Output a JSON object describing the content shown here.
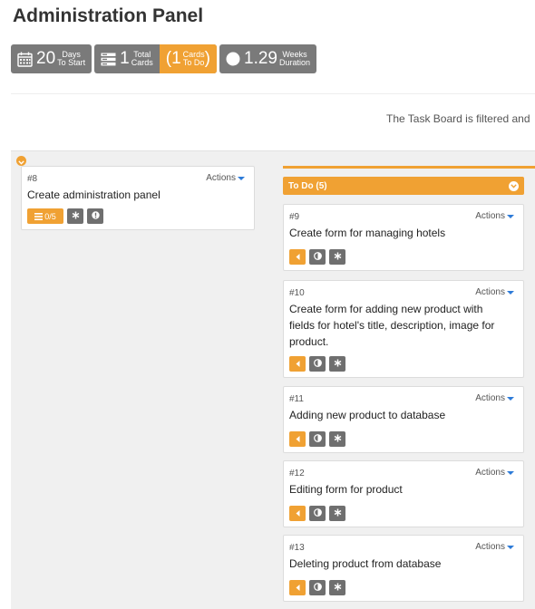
{
  "page": {
    "title": "Administration Panel"
  },
  "stats": {
    "days": {
      "value": "20",
      "label_top": "Days",
      "label_bottom": "To Start"
    },
    "cards": {
      "value": "1",
      "label_top": "Total",
      "label_bottom": "Cards"
    },
    "todo": {
      "open": "(1",
      "label_top": "Cards",
      "label_bottom": "To Do",
      "close": ")"
    },
    "weeks": {
      "value": "1.29",
      "label_top": "Weeks",
      "label_bottom": "Duration"
    }
  },
  "filter_note": "The Task Board is filtered and",
  "parent_card": {
    "number": "#8",
    "actions_label": "Actions",
    "title": "Create administration panel",
    "tasks_badge": "0/5"
  },
  "column": {
    "title": "To Do (5)",
    "cards": [
      {
        "number": "#9",
        "actions_label": "Actions",
        "title_lines": [
          "Create form for managing hotels"
        ]
      },
      {
        "number": "#10",
        "actions_label": "Actions",
        "title_lines": [
          "Create form for adding new product with",
          "fields for hotel's title, description, image for",
          "product."
        ]
      },
      {
        "number": "#11",
        "actions_label": "Actions",
        "title_lines": [
          "Adding new product to database"
        ]
      },
      {
        "number": "#12",
        "actions_label": "Actions",
        "title_lines": [
          "Editing form for product"
        ]
      },
      {
        "number": "#13",
        "actions_label": "Actions",
        "title_lines": [
          "Deleting product from database"
        ]
      }
    ]
  },
  "colors": {
    "accent": "#f0a133",
    "stat_gray": "#7a7a7a",
    "badge_gray": "#6f6f6f",
    "actions_caret": "#2d7bd8"
  },
  "icons": {
    "days": "calendar-icon",
    "cards": "cards-stack-icon",
    "weeks": "circle-icon",
    "collapse": "chevron-down-icon",
    "tasks": "list-icon",
    "asterisk": "asterisk-icon",
    "alert": "exclamation-icon",
    "move_left": "caret-left-icon",
    "half": "half-circle-icon"
  }
}
